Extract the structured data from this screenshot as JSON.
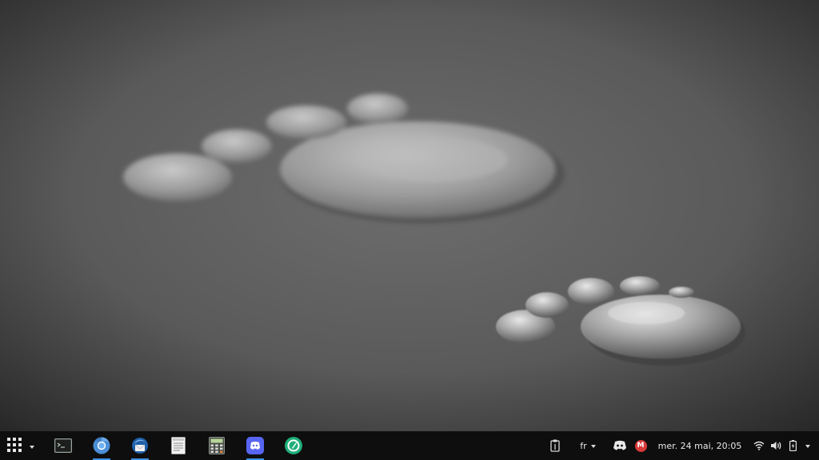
{
  "desktop": {
    "wallpaper": "water-drop-footprints"
  },
  "taskbar": {
    "background": "#0e0e0e",
    "accent": "#3d8fe0",
    "launcher_icon": "app-grid-icon",
    "apps": [
      {
        "name": "terminal",
        "icon": "terminal-icon",
        "active": false
      },
      {
        "name": "chromium",
        "icon": "chromium-icon",
        "active": true
      },
      {
        "name": "thunderbird",
        "icon": "thunderbird-icon",
        "active": true
      },
      {
        "name": "text-editor",
        "icon": "text-editor-icon",
        "active": false
      },
      {
        "name": "calculator",
        "icon": "calculator-icon",
        "active": false
      },
      {
        "name": "discord",
        "icon": "discord-icon",
        "active": true
      },
      {
        "name": "app-green",
        "icon": "green-circle-app-icon",
        "active": false
      }
    ],
    "tray": {
      "clipboard_icon": "clipboard-icon",
      "keyboard_layout": "fr",
      "discord_icon": "discord-tray-icon",
      "mail_badge_icon": "gmail-badge-icon",
      "mail_badge_letter": "M",
      "clock": "mer. 24 mai, 20:05",
      "wifi_icon": "wifi-icon",
      "volume_icon": "volume-icon",
      "battery_icon": "battery-icon"
    }
  }
}
